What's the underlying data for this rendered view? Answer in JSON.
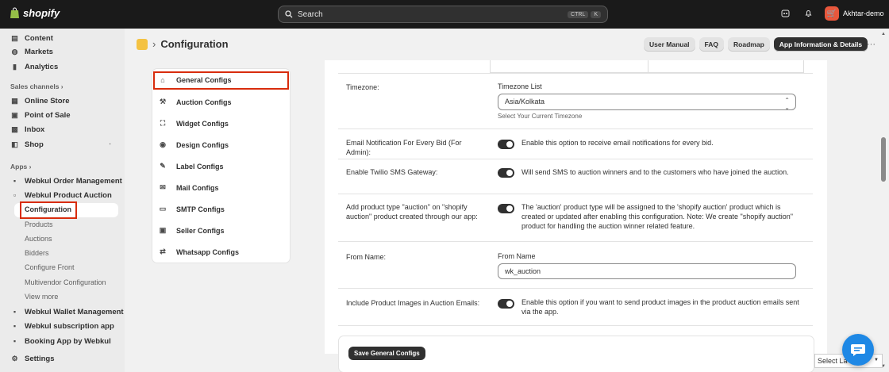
{
  "topbar": {
    "brand": "shopify",
    "search_placeholder": "Search",
    "key1": "CTRL",
    "key2": "K",
    "user_name": "Akhtar-demo"
  },
  "sidebar": {
    "top_items": [
      {
        "label": "Content",
        "icon": "content-icon"
      },
      {
        "label": "Markets",
        "icon": "globe-icon"
      },
      {
        "label": "Analytics",
        "icon": "bar-chart-icon"
      }
    ],
    "sales_channels_label": "Sales channels",
    "channels": [
      {
        "label": "Online Store",
        "icon": "store-icon"
      },
      {
        "label": "Point of Sale",
        "icon": "pos-icon"
      },
      {
        "label": "Inbox",
        "icon": "inbox-icon"
      },
      {
        "label": "Shop",
        "icon": "shop-icon"
      }
    ],
    "apps_label": "Apps",
    "apps": [
      {
        "label": "Webkul Order Management"
      },
      {
        "label": "Webkul Product Auction"
      }
    ],
    "auction_sub": [
      "Configuration",
      "Products",
      "Auctions",
      "Bidders",
      "Configure Front",
      "Multivendor Configuration",
      "View more"
    ],
    "more_apps": [
      {
        "label": "Webkul Wallet Management"
      },
      {
        "label": "Webkul subscription app"
      },
      {
        "label": "Booking App by Webkul"
      }
    ],
    "settings_label": "Settings"
  },
  "header": {
    "title": "Configuration",
    "buttons": [
      "User Manual",
      "FAQ",
      "Roadmap",
      "App Information & Details"
    ]
  },
  "menu": [
    {
      "label": "General Configs",
      "icon": "home-icon"
    },
    {
      "label": "Auction Configs",
      "icon": "gavel-icon"
    },
    {
      "label": "Widget Configs",
      "icon": "widget-icon"
    },
    {
      "label": "Design Configs",
      "icon": "eye-icon"
    },
    {
      "label": "Label Configs",
      "icon": "label-icon"
    },
    {
      "label": "Mail Configs",
      "icon": "mail-icon"
    },
    {
      "label": "SMTP Configs",
      "icon": "smtp-icon"
    },
    {
      "label": "Seller Configs",
      "icon": "seller-icon"
    },
    {
      "label": "Whatsapp Configs",
      "icon": "whatsapp-icon"
    }
  ],
  "form": {
    "timezone_label": "Timezone:",
    "timezone_field_label": "Timezone List",
    "timezone_value": "Asia/Kolkata",
    "timezone_help": "Select Your Current Timezone",
    "email_label": "Email Notification For Every Bid (For Admin):",
    "email_desc": "Enable this option to receive email notifications for every bid.",
    "twilio_label": "Enable Twilio SMS Gateway:",
    "twilio_desc": "Will send SMS to auction winners and to the customers who have joined the auction.",
    "ptype_label": "Add product type \"auction\" on \"shopify auction\" product created through our app:",
    "ptype_desc": "The 'auction' product type will be assigned to the 'shopify auction' product which is created or updated after enabling this configuration. Note: We create \"shopify auction\" product for handling the auction winner related feature.",
    "from_label": "From Name:",
    "from_field_label": "From Name",
    "from_value": "wk_auction",
    "images_label": "Include Product Images in Auction Emails:",
    "images_desc": "Enable this option if you want to send product images in the product auction emails sent via the app.",
    "save_label": "Save General Configs"
  },
  "language": "Select La"
}
